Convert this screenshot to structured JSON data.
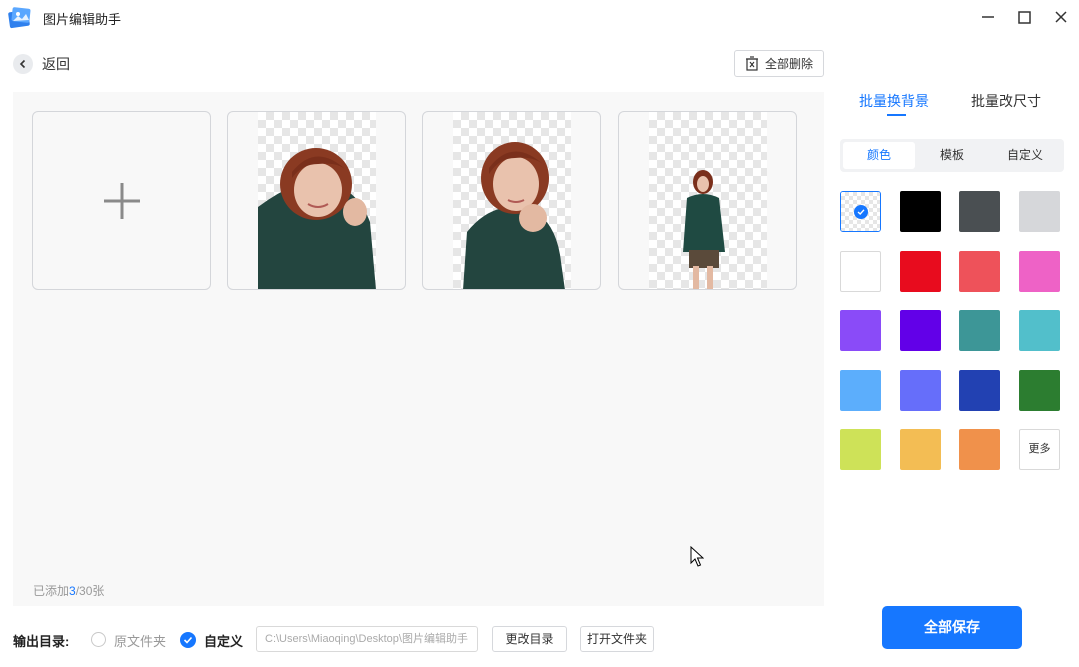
{
  "window": {
    "title": "图片编辑助手"
  },
  "toolbar": {
    "back_label": "返回",
    "delete_all_label": "全部删除"
  },
  "workspace": {
    "count_prefix": "已添加",
    "count_current": "3",
    "count_suffix": "/30张",
    "images": [
      {
        "name": "photo-woman-closeup-1"
      },
      {
        "name": "photo-woman-closeup-2"
      },
      {
        "name": "photo-woman-fullbody"
      }
    ]
  },
  "output": {
    "label": "输出目录:",
    "option_original": "原文件夹",
    "option_custom": "自定义",
    "path": "C:\\Users\\Miaoqing\\Desktop\\图片编辑助手",
    "change_dir": "更改目录",
    "open_folder": "打开文件夹"
  },
  "panel": {
    "tabs": [
      "批量换背景",
      "批量改尺寸"
    ],
    "active_tab": 0,
    "subtabs": [
      "颜色",
      "模板",
      "自定义"
    ],
    "active_subtab": 0,
    "more_label": "更多",
    "colors": [
      "transparent",
      "#000000",
      "#4a4f52",
      "#d6d7da",
      "#ffffff",
      "#e80c1e",
      "#ee525a",
      "#ee62c6",
      "#8a4bf8",
      "#6200e8",
      "#3d9697",
      "#52bfcb",
      "#5caefc",
      "#666efa",
      "#2241b2",
      "#2c7d30",
      "#cee258",
      "#f3bd54",
      "#f0914b",
      "more"
    ],
    "selected_color_index": 0,
    "save_all": "全部保存"
  }
}
